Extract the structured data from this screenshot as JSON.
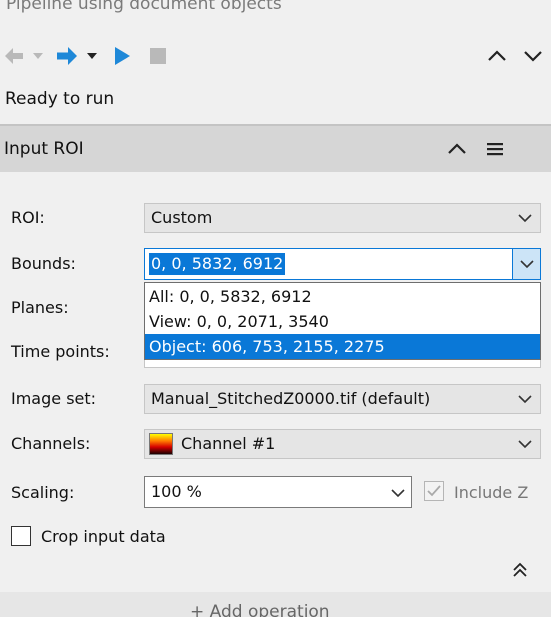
{
  "window": {
    "title": "Pipeline using document objects"
  },
  "toolbar": {
    "back_icon": "arrow-left-icon",
    "forward_icon": "arrow-right-icon",
    "run_icon": "play-icon",
    "stop_icon": "stop-icon",
    "collapse_icon": "chevron-up-icon",
    "expand_icon": "chevron-down-icon",
    "accent": "#1e88d8"
  },
  "status": {
    "text": "Ready to run"
  },
  "section": {
    "title": "Input ROI"
  },
  "form": {
    "roi": {
      "label": "ROI:",
      "value": "Custom"
    },
    "bounds": {
      "label": "Bounds:",
      "value": "0, 0, 5832, 6912",
      "options": [
        "All: 0, 0, 5832, 6912",
        "View: 0, 0, 2071, 3540",
        "Object: 606, 753, 2155, 2275"
      ],
      "highlighted_option": 2
    },
    "planes": {
      "label": "Planes:"
    },
    "time_points": {
      "label": "Time points:"
    },
    "image_set": {
      "label": "Image set:",
      "value": "Manual_StitchedZ0000.tif (default)"
    },
    "channels": {
      "label": "Channels:",
      "value": "Channel #1"
    },
    "scaling": {
      "label": "Scaling:",
      "value": "100 %"
    },
    "include_z": {
      "label": "Include Z",
      "checked": true,
      "enabled": false
    },
    "crop_input": {
      "label": "Crop input data",
      "checked": false
    }
  },
  "footer": {
    "add_operation": "+ Add operation"
  },
  "colors": {
    "selection": "#0a78d7",
    "header_bg": "#d6d6d6",
    "panel_bg": "#f0f0f0"
  }
}
